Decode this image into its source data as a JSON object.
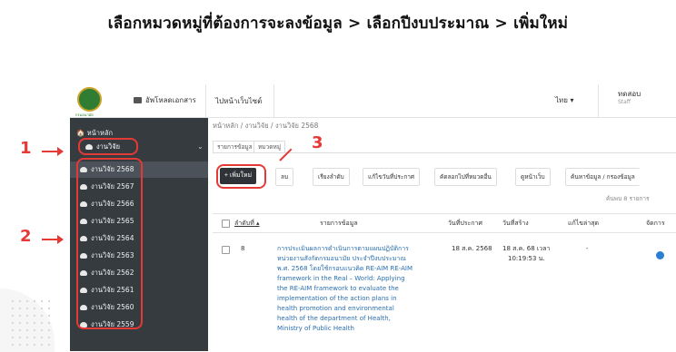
{
  "headline": "เลือกหมวดหมู่ที่ต้องการจะลงข้อมูล > เลือกปีงบประมาณ > เพิ่มใหม่",
  "topbar": {
    "logo_text": "กรมอนามัย",
    "upload_label": "อัพโหลดเอกสาร",
    "website_tab": "ไปหน้าเว็บไซต์",
    "language": "ไทย ▾",
    "user_name": "ทดสอบ",
    "user_role": "Staff"
  },
  "sidebar": {
    "home": "หน้าหลัก",
    "section": "งานวิจัย",
    "items": [
      "งานวิจัย 2568",
      "งานวิจัย 2567",
      "งานวิจัย 2566",
      "งานวิจัย 2565",
      "งานวิจัย 2564",
      "งานวิจัย 2563",
      "งานวิจัย 2562",
      "งานวิจัย 2561",
      "งานวิจัย 2560",
      "งานวิจัย 2559"
    ]
  },
  "breadcrumb": "หน้าหลัก  /  งานวิจัย  /  งานวิจัย 2568",
  "tabs": [
    "รายการข้อมูล",
    "หมวดหมู่"
  ],
  "toolbar": {
    "add": "+ เพิ่มใหม่",
    "delete": "ลบ",
    "sort": "เรียงลำดับ",
    "update_date": "แก้ไขวันที่ประกาศ",
    "copy": "คัดลอกไปที่หมวดอื่น",
    "view_site": "ดูหน้าเว็บ",
    "search": "ค้นหาข้อมูล / กรองข้อมูล"
  },
  "count_text": "ค้นพบ 8 รายการ",
  "table": {
    "headers": [
      "ลำดับที่ ▴",
      "รายการข้อมูล",
      "วันที่ประกาศ",
      "วันที่สร้าง",
      "แก้ไขล่าสุด",
      "จัดการ"
    ],
    "row": {
      "order": "8",
      "title_lines": [
        "การประเมินผลการดำเนินการตามแผนปฏิบัติการ",
        "หน่วยงานสังกัดกรมอนามัย ประจำปีงบประมาณ",
        "พ.ศ. 2568 โดยใช้กรอบแนวคิด RE-AIM RE-AIM",
        "framework in the Real – World: Applying",
        "the RE-AIM framework to evaluate the",
        "implementation of the action plans in",
        "health promotion and environmental",
        "health of the department of Health,",
        "Ministry of Public Health"
      ],
      "announce_date": "18 ส.ค. 2568",
      "created_line1": "18 ส.ค. 68 เวลา",
      "created_line2": "10:19:53 น.",
      "last_edit": "-"
    }
  },
  "annotations": [
    "1",
    "2",
    "3"
  ]
}
